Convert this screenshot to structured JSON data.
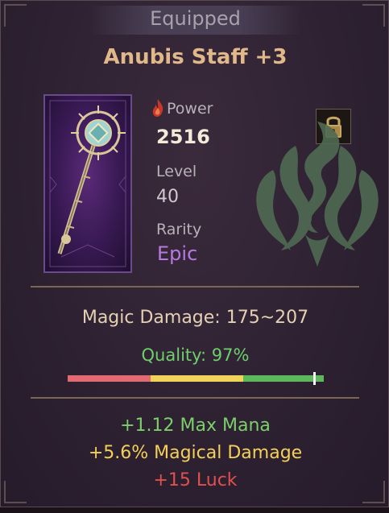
{
  "tooltip": {
    "status": "Equipped",
    "item_name": "Anubis Staff +3",
    "stats": {
      "power_label": "Power",
      "power_value": "2516",
      "level_label": "Level",
      "level_value": "40",
      "rarity_label": "Rarity",
      "rarity_value": "Epic"
    },
    "magic_damage": "Magic Damage: 175~207",
    "quality_text": "Quality: 97%",
    "quality_percent": 97,
    "bonuses": [
      "+1.12 Max Mana",
      "+5.6% Magical Damage",
      "+15 Luck"
    ]
  },
  "colors": {
    "title": "#e0b88a",
    "rarity_epic": "#b57be0",
    "quality": "#6fcf6a",
    "bonus_mana": "#7ccf6a",
    "bonus_damage": "#f4d05a",
    "bonus_luck": "#e0504e"
  },
  "icons": {
    "item": "staff-icon",
    "power": "flame-icon",
    "lock": "lock-icon",
    "class": "class-emblem-icon"
  }
}
